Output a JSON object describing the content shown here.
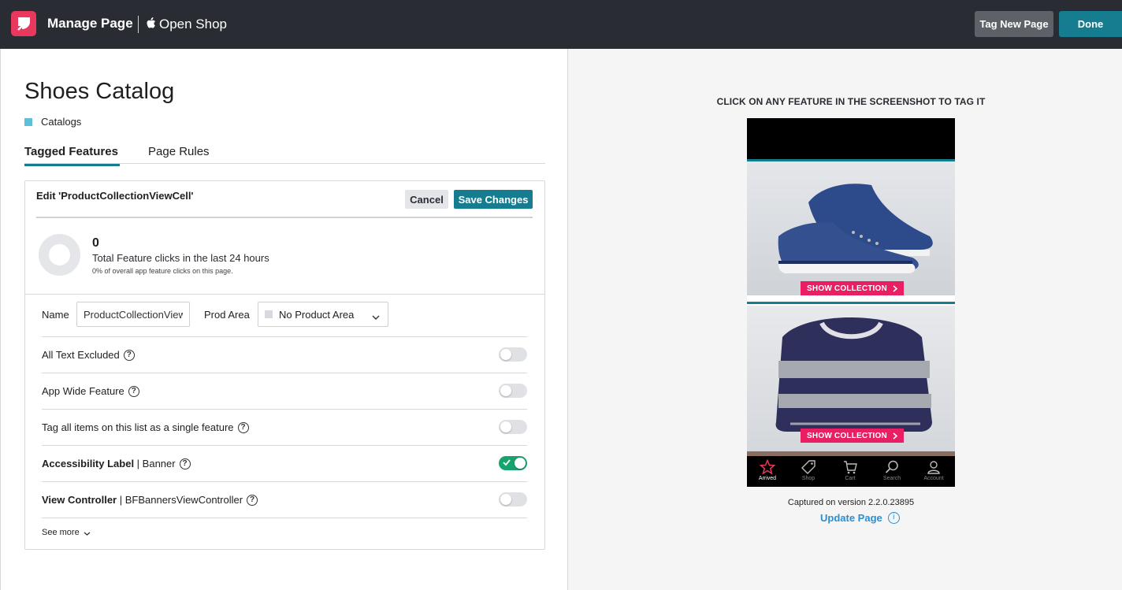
{
  "header": {
    "title": "Manage Page",
    "app_name": "Open Shop",
    "tag_new_page_label": "Tag New Page",
    "done_label": "Done",
    "logo_icon": "pendo-logo-icon",
    "platform_icon": "apple-icon"
  },
  "page": {
    "title": "Shoes Catalog",
    "category": "Catalogs",
    "category_color": "#5ec0d6"
  },
  "tabs": [
    {
      "label": "Tagged Features",
      "active": true
    },
    {
      "label": "Page Rules",
      "active": false
    }
  ],
  "edit": {
    "title": "Edit 'ProductCollectionViewCell'",
    "cancel_label": "Cancel",
    "save_label": "Save Changes",
    "stats": {
      "count": "0",
      "label": "Total Feature clicks in the last 24 hours",
      "sub": "0% of overall app feature clicks on this page."
    },
    "name_label": "Name",
    "name_value": "ProductCollectionViewCell",
    "prod_area_label": "Prod Area",
    "prod_area_value": "No Product Area",
    "settings": [
      {
        "label": "All Text Excluded",
        "bold": "",
        "value": "",
        "enabled": false
      },
      {
        "label": "App Wide Feature",
        "bold": "",
        "value": "",
        "enabled": false
      },
      {
        "label": "Tag all items on this list as a single feature",
        "bold": "",
        "value": "",
        "enabled": false
      },
      {
        "label": "",
        "bold": "Accessibility Label",
        "value": " | Banner",
        "enabled": true
      },
      {
        "label": "",
        "bold": "View Controller",
        "value": " | BFBannersViewController",
        "enabled": false
      }
    ],
    "see_more_label": "See more"
  },
  "preview": {
    "instructions": "CLICK ON ANY FEATURE IN THE SCREENSHOT TO TAG IT",
    "show_collection_label": "SHOW COLLECTION",
    "tabbar": [
      {
        "label": "Arrived",
        "icon": "star-icon",
        "active": true
      },
      {
        "label": "Shop",
        "icon": "tag-icon",
        "active": false
      },
      {
        "label": "Cart",
        "icon": "cart-icon",
        "active": false
      },
      {
        "label": "Search",
        "icon": "search-icon",
        "active": false
      },
      {
        "label": "Account",
        "icon": "account-icon",
        "active": false
      }
    ],
    "captured_text": "Captured on version 2.2.0.23895",
    "update_label": "Update Page"
  },
  "colors": {
    "topbar": "#2a2c33",
    "accent": "#157d8f",
    "brand": "#e9385e",
    "toggle_on": "#17a36c",
    "show_collection": "#e91e63",
    "link": "#2a8fd0"
  }
}
